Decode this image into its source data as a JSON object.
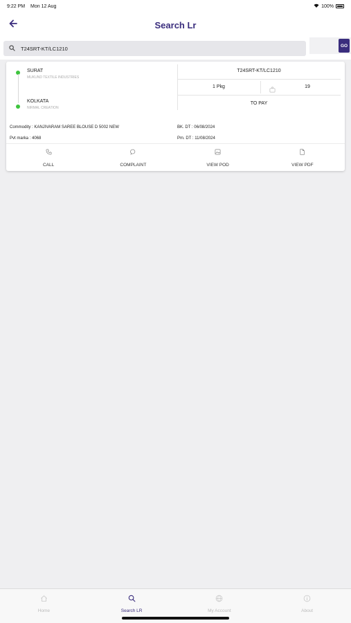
{
  "status": {
    "time": "9:22 PM",
    "date": "Mon 12 Aug",
    "battery": "100%"
  },
  "header": {
    "title": "Search Lr"
  },
  "search": {
    "value": "T24SRT-KT/LC1210",
    "go_label": "GO"
  },
  "result": {
    "origin_city": "SURAT",
    "origin_party": "MUKUND TEXTILE INDUSTRIES",
    "dest_city": "KOLKATA",
    "dest_party": "NIRMAL CREATION",
    "lr_number": "T24SRT-KT/LC1210",
    "packages": "1 Pkg",
    "weight": "19",
    "payment": "TO PAY",
    "commodity": "Commodity : KANJIVARAM SAREE BLOUSE D 5002 NEW",
    "pvt_marka": "Pvt marka : 4068",
    "booking_date": "BK. DT : 06/08/2024",
    "pm_date": "Pm. DT : 11/08/2024"
  },
  "actions": [
    {
      "label": "CALL",
      "icon": "phone-icon"
    },
    {
      "label": "COMPLAINT",
      "icon": "chat-icon"
    },
    {
      "label": "VIEW POD",
      "icon": "image-icon"
    },
    {
      "label": "VIEW PDF",
      "icon": "document-icon"
    }
  ],
  "tabs": [
    {
      "label": "Home",
      "icon": "home-icon"
    },
    {
      "label": "Search LR",
      "icon": "search-icon",
      "active": true
    },
    {
      "label": "My Account",
      "icon": "globe-icon"
    },
    {
      "label": "About",
      "icon": "info-icon"
    }
  ],
  "colors": {
    "brand": "#3a2d7d",
    "status_dot": "#3ec43e",
    "background": "#efeff1"
  }
}
